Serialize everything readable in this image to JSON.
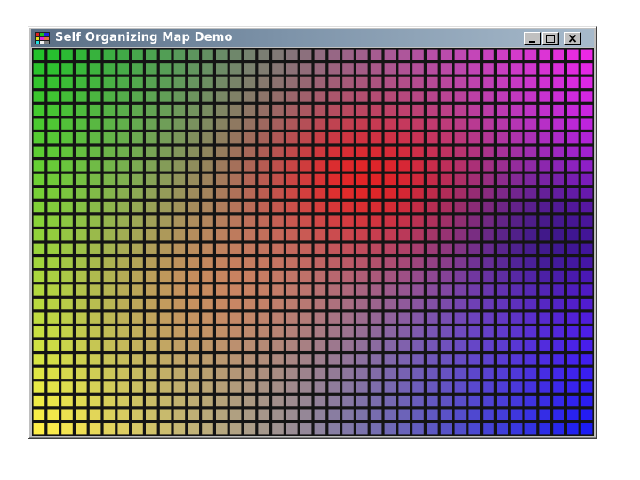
{
  "window": {
    "title": "Self Organizing Map Demo",
    "app_icon": "grid-app-icon",
    "controls": {
      "minimize_icon": "minimize-icon",
      "maximize_icon": "maximize-icon",
      "close_icon": "close-icon"
    }
  },
  "som": {
    "columns": 40,
    "rows": 28,
    "corner_colors": {
      "top_left": "#22c22a",
      "top_right": "#ec28e6",
      "bottom_left": "#fff048",
      "bottom_right": "#1c1cf4"
    },
    "anchor_colors": {
      "red": "#e81c1c",
      "salmon": "#f07850",
      "navy": "#0a0a5a"
    }
  }
}
